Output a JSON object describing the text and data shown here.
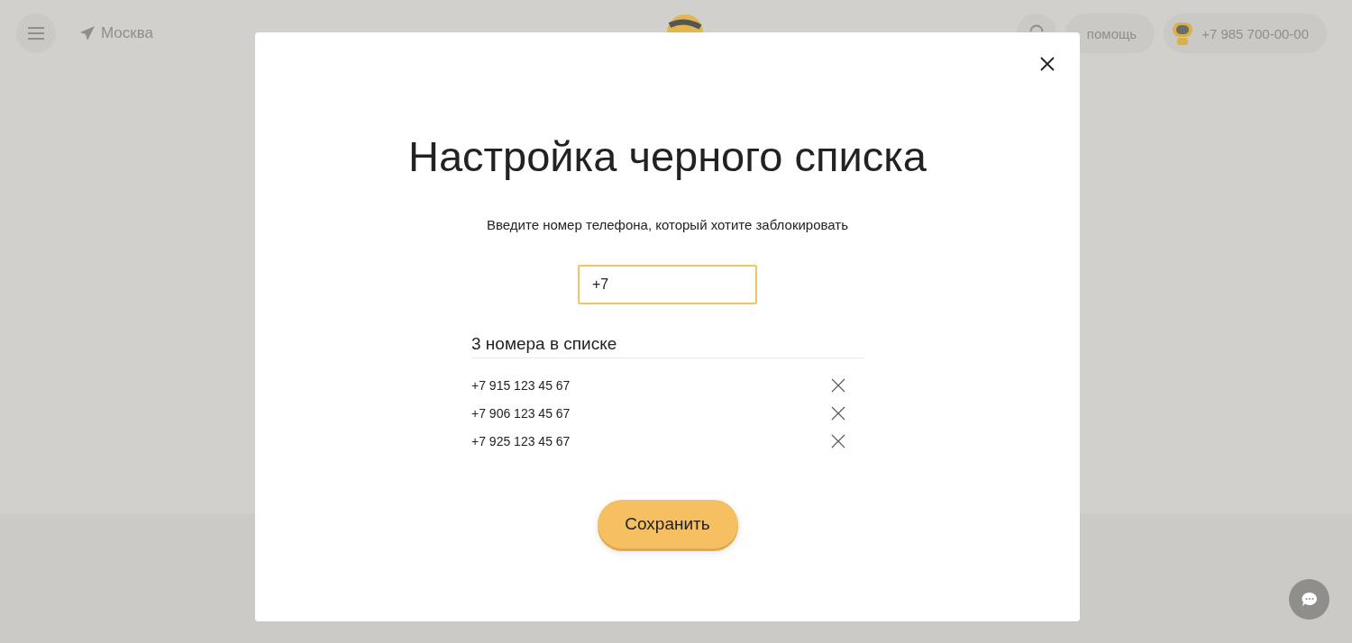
{
  "header": {
    "city": "Москва",
    "help": "помощь",
    "phone": "+7 985 700-00-00"
  },
  "dialog": {
    "title": "Настройка черного списка",
    "prompt": "Введите номер телефона, который хотите заблокировать",
    "phone_field": {
      "value": "+7"
    },
    "list_heading": "3 номера в списке",
    "numbers": [
      "+7 915 123 45 67",
      "+7 906 123 45 67",
      "+7 925 123 45 67"
    ],
    "save_button": "Сохранить"
  }
}
